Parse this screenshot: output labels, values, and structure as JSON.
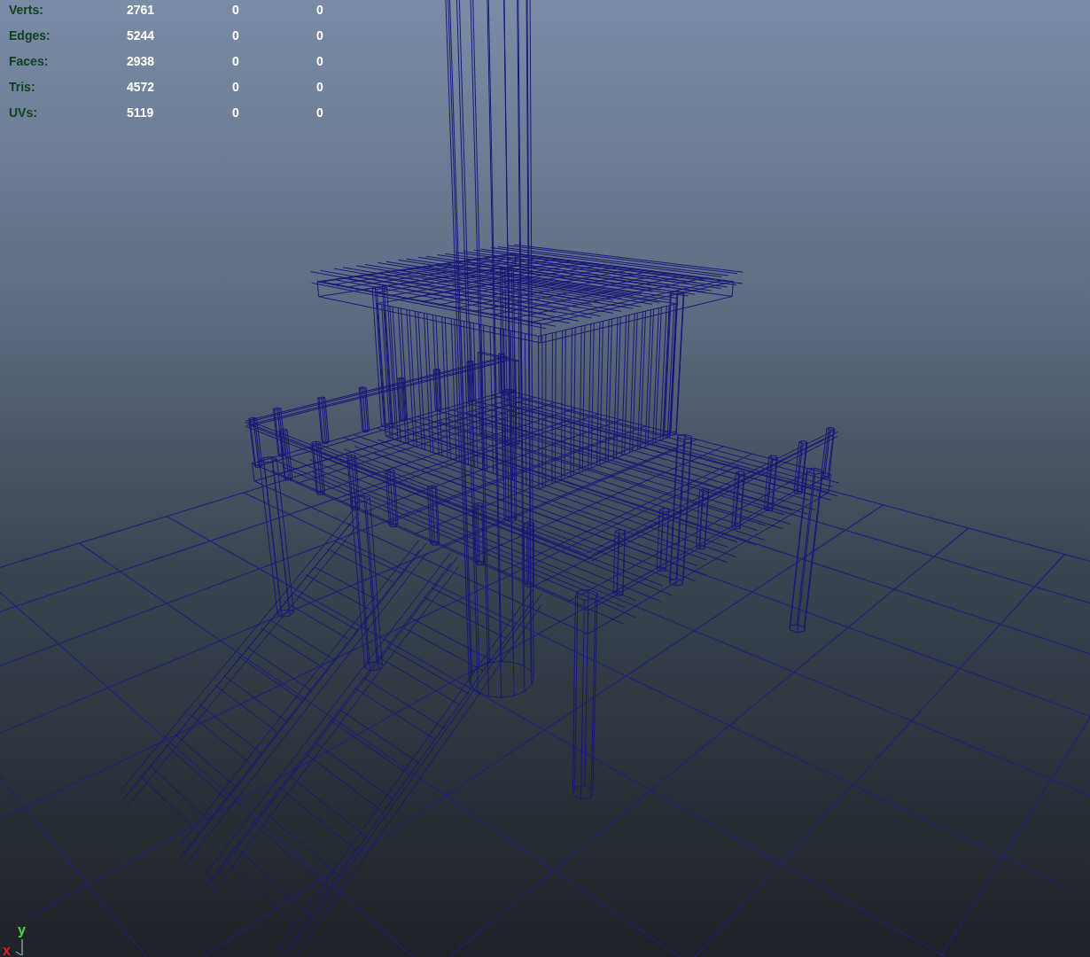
{
  "viewport": {
    "hud": [
      {
        "label": "Verts:",
        "values": [
          "2761",
          "0",
          "0"
        ]
      },
      {
        "label": "Edges:",
        "values": [
          "5244",
          "0",
          "0"
        ]
      },
      {
        "label": "Faces:",
        "values": [
          "2938",
          "0",
          "0"
        ]
      },
      {
        "label": "Tris:",
        "values": [
          "4572",
          "0",
          "0"
        ]
      },
      {
        "label": "UVs:",
        "values": [
          "5119",
          "0",
          "0"
        ]
      }
    ],
    "axes": [
      {
        "label": "y",
        "color": "#44e03c"
      },
      {
        "label": "x",
        "color": "#e0202a"
      }
    ]
  }
}
